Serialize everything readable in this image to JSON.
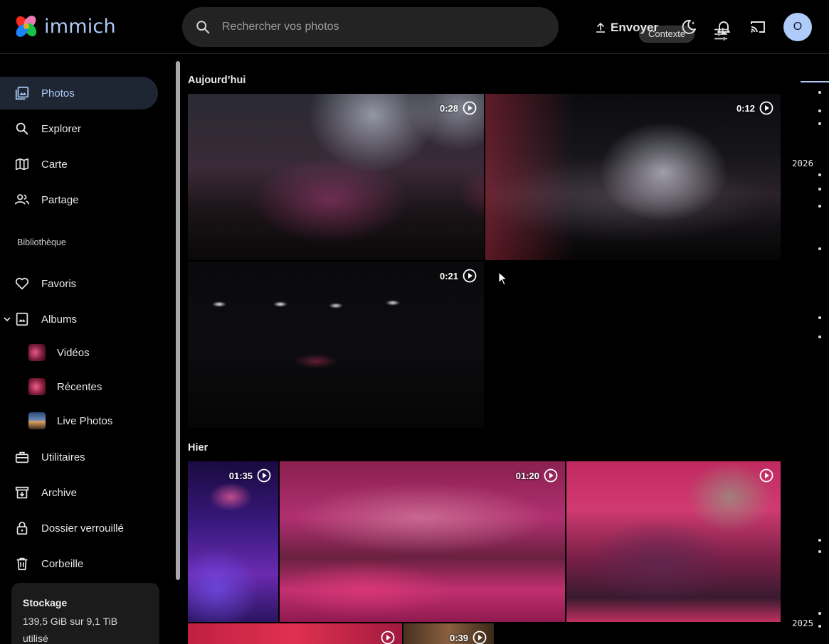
{
  "app": {
    "name": "immich"
  },
  "search": {
    "placeholder": "Rechercher vos photos",
    "context_chip": "Contexte"
  },
  "header": {
    "upload_label": "Envoyer",
    "avatar_initial": "O"
  },
  "sidebar": {
    "items": [
      {
        "label": "Photos",
        "icon": "photos-icon",
        "active": true
      },
      {
        "label": "Explorer",
        "icon": "search-icon"
      },
      {
        "label": "Carte",
        "icon": "map-icon"
      },
      {
        "label": "Partage",
        "icon": "people-icon"
      }
    ],
    "library_label": "Bibliothèque",
    "library_items": [
      {
        "label": "Favoris",
        "icon": "heart-icon"
      },
      {
        "label": "Albums",
        "icon": "album-icon"
      }
    ],
    "albums": [
      {
        "label": "Vidéos"
      },
      {
        "label": "Récentes"
      },
      {
        "label": "Live Photos"
      }
    ],
    "tools": [
      {
        "label": "Utilitaires",
        "icon": "toolbox-icon"
      },
      {
        "label": "Archive",
        "icon": "archive-icon"
      },
      {
        "label": "Dossier verrouillé",
        "icon": "lock-icon"
      },
      {
        "label": "Corbeille",
        "icon": "trash-icon"
      }
    ],
    "storage": {
      "title": "Stockage",
      "line1": "139,5 GiB sur 9,1 TiB",
      "line2": "utilisé"
    }
  },
  "groups": [
    {
      "title": "Aujourd’hui",
      "tiles": [
        {
          "duration": "0:28"
        },
        {
          "duration": "0:12"
        },
        {
          "duration": "0:21"
        }
      ]
    },
    {
      "title": "Hier",
      "tiles": [
        {
          "duration": "01:35"
        },
        {
          "duration": "01:20"
        },
        {
          "duration": ""
        },
        {
          "duration": ""
        },
        {
          "duration": "0:39"
        }
      ]
    }
  ],
  "timeline": {
    "years": [
      "2026",
      "2025"
    ]
  },
  "colors": {
    "accent": "#aecbfa",
    "active_bg": "#1e2633",
    "search_bg": "#232323"
  }
}
